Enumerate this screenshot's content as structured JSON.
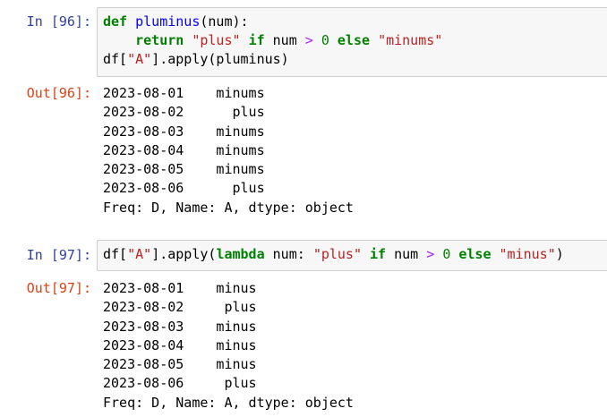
{
  "cells": [
    {
      "in_prompt": "In [96]:",
      "out_prompt": "Out[96]:",
      "code_tokens": [
        [
          {
            "t": "def",
            "c": "kw"
          },
          {
            "t": " ",
            "c": ""
          },
          {
            "t": "pluminus",
            "c": "fn"
          },
          {
            "t": "(num):",
            "c": ""
          }
        ],
        [
          {
            "t": "    ",
            "c": ""
          },
          {
            "t": "return",
            "c": "kw"
          },
          {
            "t": " ",
            "c": ""
          },
          {
            "t": "\"plus\"",
            "c": "str"
          },
          {
            "t": " ",
            "c": ""
          },
          {
            "t": "if",
            "c": "kw"
          },
          {
            "t": " num ",
            "c": ""
          },
          {
            "t": ">",
            "c": "op"
          },
          {
            "t": " ",
            "c": ""
          },
          {
            "t": "0",
            "c": "num"
          },
          {
            "t": " ",
            "c": ""
          },
          {
            "t": "else",
            "c": "kw"
          },
          {
            "t": " ",
            "c": ""
          },
          {
            "t": "\"minums\"",
            "c": "str"
          }
        ],
        [
          {
            "t": "df[",
            "c": ""
          },
          {
            "t": "\"A\"",
            "c": "str"
          },
          {
            "t": "].apply(pluminus)",
            "c": ""
          }
        ]
      ],
      "output_lines": [
        "2023-08-01    minums",
        "2023-08-02      plus",
        "2023-08-03    minums",
        "2023-08-04    minums",
        "2023-08-05    minums",
        "2023-08-06      plus",
        "Freq: D, Name: A, dtype: object"
      ]
    },
    {
      "in_prompt": "In [97]:",
      "out_prompt": "Out[97]:",
      "code_tokens": [
        [
          {
            "t": "df[",
            "c": ""
          },
          {
            "t": "\"A\"",
            "c": "str"
          },
          {
            "t": "].apply(",
            "c": ""
          },
          {
            "t": "lambda",
            "c": "kw"
          },
          {
            "t": " num: ",
            "c": ""
          },
          {
            "t": "\"plus\"",
            "c": "str"
          },
          {
            "t": " ",
            "c": ""
          },
          {
            "t": "if",
            "c": "kw"
          },
          {
            "t": " num ",
            "c": ""
          },
          {
            "t": ">",
            "c": "op"
          },
          {
            "t": " ",
            "c": ""
          },
          {
            "t": "0",
            "c": "num"
          },
          {
            "t": " ",
            "c": ""
          },
          {
            "t": "else",
            "c": "kw"
          },
          {
            "t": " ",
            "c": ""
          },
          {
            "t": "\"minus\"",
            "c": "str"
          },
          {
            "t": ")",
            "c": ""
          }
        ]
      ],
      "output_lines": [
        "2023-08-01    minus",
        "2023-08-02     plus",
        "2023-08-03    minus",
        "2023-08-04    minus",
        "2023-08-05    minus",
        "2023-08-06     plus",
        "Freq: D, Name: A, dtype: object"
      ]
    }
  ]
}
